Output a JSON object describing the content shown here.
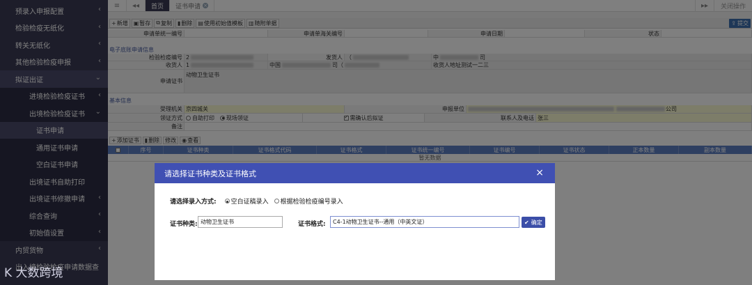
{
  "sidebar": {
    "items": [
      {
        "label": "预录入申报配置",
        "level": 0
      },
      {
        "label": "检验检疫无纸化",
        "level": 0
      },
      {
        "label": "转关无纸化",
        "level": 0
      },
      {
        "label": "其他检验检疫申报",
        "level": 0
      },
      {
        "label": "拟证出证",
        "level": 0
      },
      {
        "label": "进境检验检疫证书",
        "level": 1
      },
      {
        "label": "出境检验检疫证书",
        "level": 1
      },
      {
        "label": "证书申请",
        "level": 2
      },
      {
        "label": "通用证书申请",
        "level": 2
      },
      {
        "label": "空白证书申请",
        "level": 2
      },
      {
        "label": "出境证书自助打印",
        "level": 1
      },
      {
        "label": "出境证书修撤申请",
        "level": 1
      },
      {
        "label": "综合查询",
        "level": 1
      },
      {
        "label": "初始值设置",
        "level": 1
      },
      {
        "label": "内贸货物",
        "level": 0
      },
      {
        "label": "出入境检验检疫申请数据查",
        "level": 0
      }
    ]
  },
  "topbar": {
    "home_tab": "首页",
    "active_tab": "证书申请",
    "close_ops": "关闭操作"
  },
  "toolbar": {
    "buttons": [
      "新增",
      "暂存",
      "复制",
      "删除",
      "使用初始值模板",
      "随附单据"
    ],
    "submit": "提交"
  },
  "form": {
    "header_row": [
      "申请单统一编号",
      "申请单海关编号",
      "申请日期",
      "状态"
    ],
    "section_ebill": "电子底账申请信息",
    "insp_no_label": "检验检疫编号",
    "insp_no_value": "2",
    "consignor_label": "发货人",
    "consignor_value": "（",
    "consignor_extra": "中",
    "consignor_extra2": "司",
    "consignee_label": "收货人",
    "consignee_value": "1",
    "consignee_country": "中国",
    "consignee_mid": "司（",
    "consignee_addr": "收货人地址测试一二三",
    "apply_cert_label": "申请证书",
    "apply_cert_value": "动物卫生证书",
    "section_basic": "基本信息",
    "org_label": "受理机关",
    "org_value": "京四城关",
    "unit_label": "申报单位",
    "unit_suffix": "公司",
    "receive_label": "领证方式",
    "receive_opt1": "自助打印",
    "receive_opt2": "现场领证",
    "confirm_label": "需确认后拟证",
    "contact_label": "联系人及电话",
    "contact_value": "张三",
    "remark_label": "备注"
  },
  "cert_table": {
    "buttons": [
      "添加证书",
      "删除",
      "修改",
      "查看"
    ],
    "headers": [
      "序号",
      "证书种类",
      "证书格式代码",
      "证书格式",
      "证书统一编号",
      "证书编号",
      "证书状态",
      "正本数量",
      "副本数量"
    ],
    "empty": "暂无数据"
  },
  "modal": {
    "title": "请选择证书种类及证书格式",
    "mode_label": "请选择录入方式:",
    "mode_opt1": "空白证稿录入",
    "mode_opt2": "根据检验检疫编号录入",
    "type_label": "证书种类:",
    "type_value": "动物卫生证书",
    "format_label": "证书格式:",
    "format_value": "C4-1动物卫生证书--通用（中英文证）",
    "ok": "确定"
  },
  "watermark": "K 大数跨境"
}
